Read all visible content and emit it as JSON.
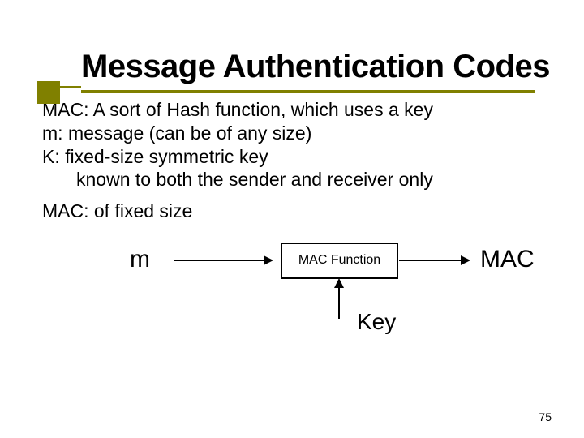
{
  "title": "Message Authentication Codes",
  "lines": {
    "l1": "MAC: A sort of Hash function, which uses a key",
    "l2": "m: message (can be of any size)",
    "l3": "K: fixed-size symmetric key",
    "l4": "known to both the sender and receiver only",
    "l5": "MAC: of fixed size"
  },
  "diagram": {
    "input": "m",
    "func": "MAC Function",
    "output": "MAC",
    "key": "Key"
  },
  "pagenum": "75"
}
